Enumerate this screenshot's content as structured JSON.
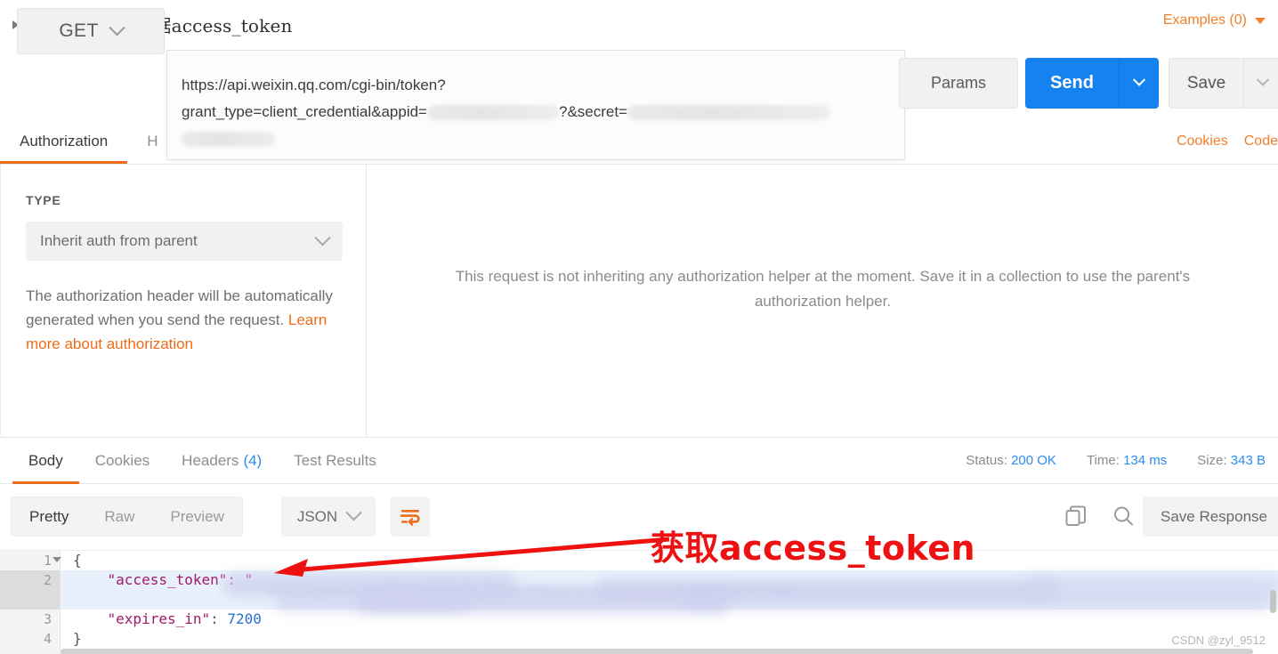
{
  "request": {
    "title": "获取接口调用凭据access_token",
    "expand_icon": "caret-right-icon",
    "examples_label": "Examples (0)",
    "method": "GET",
    "url_line1": "https://api.weixin.qq.com/cgi-bin/token?",
    "url_line2_a": "grant_type=client_credential&appid=",
    "url_line2_b": "?&secret=",
    "url_redacted_appid": "8bd1ff65",
    "url_redacted_secret": "d5617a97ced4616451",
    "params_label": "Params",
    "send_label": "Send",
    "save_label": "Save",
    "tabs": [
      {
        "label": "Authorization",
        "active": true
      },
      {
        "label": "H",
        "active": false
      }
    ],
    "right_links": [
      "Cookies",
      "Code"
    ]
  },
  "authorization": {
    "type_label": "TYPE",
    "type_value": "Inherit auth from parent",
    "note_text": "The authorization header will be automatically generated when you send the request. ",
    "note_link": "Learn more about authorization",
    "message": "This request is not inheriting any authorization helper at the moment. Save it in a collection to use the parent's authorization helper."
  },
  "response": {
    "tabs": [
      {
        "label": "Body",
        "count": "",
        "active": true
      },
      {
        "label": "Cookies",
        "count": "",
        "active": false
      },
      {
        "label": "Headers",
        "count": "(4)",
        "active": false
      },
      {
        "label": "Test Results",
        "count": "",
        "active": false
      }
    ],
    "status_label": "Status:",
    "status_value": "200 OK",
    "time_label": "Time:",
    "time_value": "134 ms",
    "size_label": "Size:",
    "size_value": "343 B",
    "view_modes": [
      {
        "label": "Pretty",
        "active": true
      },
      {
        "label": "Raw",
        "active": false
      },
      {
        "label": "Preview",
        "active": false
      }
    ],
    "format": "JSON",
    "wrap_icon": "word-wrap-icon",
    "copy_icon": "copy-icon",
    "search_icon": "search-icon",
    "save_response_label": "Save Response"
  },
  "body": {
    "lines": [
      {
        "no": "1",
        "text": "{",
        "fold": true
      },
      {
        "no": "2",
        "text": "    \"access_token\": \"",
        "highlight": true
      },
      {
        "no": "3",
        "text": "    \"expires_in\": 7200"
      },
      {
        "no": "4",
        "text": "}"
      }
    ],
    "token_redacted": "hdwXJ5gphK00tMOj2-j_yuQb1e1a_77SWkYP0kQwCwC3eYSYVsxQstmmpmkhZHBtkhswmql",
    "expires_key": "\"expires_in\"",
    "expires_value": "7200"
  },
  "annotation": {
    "text": "获取access_token",
    "color": "#ee1111",
    "arrow": "arrow-left-icon"
  },
  "watermark": "CSDN @zyl_9512",
  "colors": {
    "accent_orange": "#ef6c1a",
    "link_blue": "#2d8cf0",
    "send_blue": "#1582ef",
    "annotation_red": "#ee1111"
  }
}
